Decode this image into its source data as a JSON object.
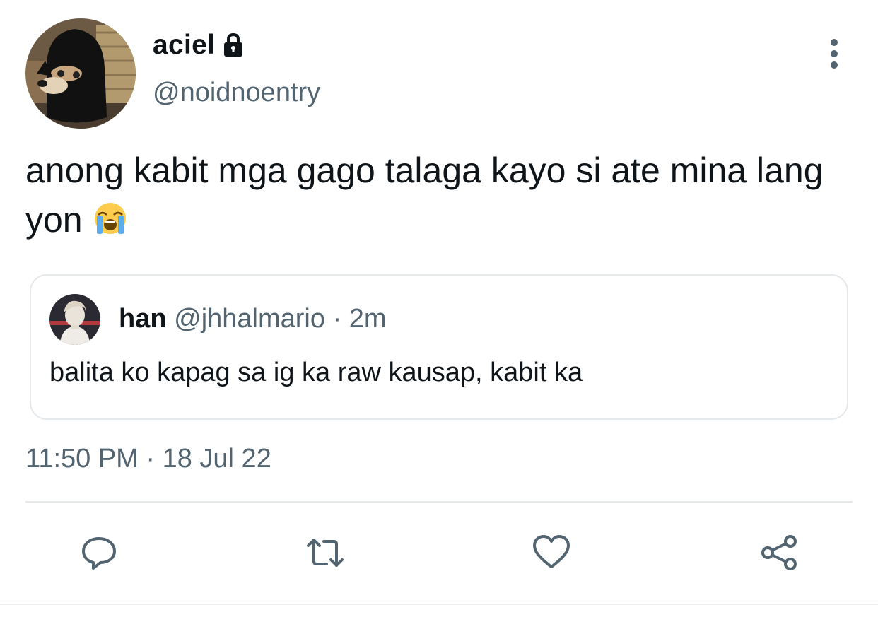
{
  "author": {
    "display_name": "aciel",
    "handle": "@noidnoentry",
    "icons": {
      "avatar": "avatar-dog-balaclava",
      "lock": "lock-icon",
      "more": "more-vertical-icon"
    }
  },
  "tweet": {
    "text": "anong kabit mga gago talaga kayo si ate mina lang yon",
    "emoji": "loudly-crying-face-emoji",
    "timestamp": "11:50 PM · 18 Jul 22"
  },
  "quoted_tweet": {
    "display_name": "han",
    "handle": "@jhhalmario",
    "separator": "·",
    "time": "2m",
    "text": "balita ko kapag sa ig ka raw kausap, kabit ka"
  },
  "actions": [
    {
      "name": "reply",
      "icon": "reply-icon"
    },
    {
      "name": "retweet",
      "icon": "retweet-icon"
    },
    {
      "name": "like",
      "icon": "heart-icon"
    },
    {
      "name": "share",
      "icon": "share-icon"
    }
  ],
  "colors": {
    "text_primary": "#0f1419",
    "text_secondary": "#536471",
    "border": "#e6e9ec",
    "icon": "#536471"
  }
}
